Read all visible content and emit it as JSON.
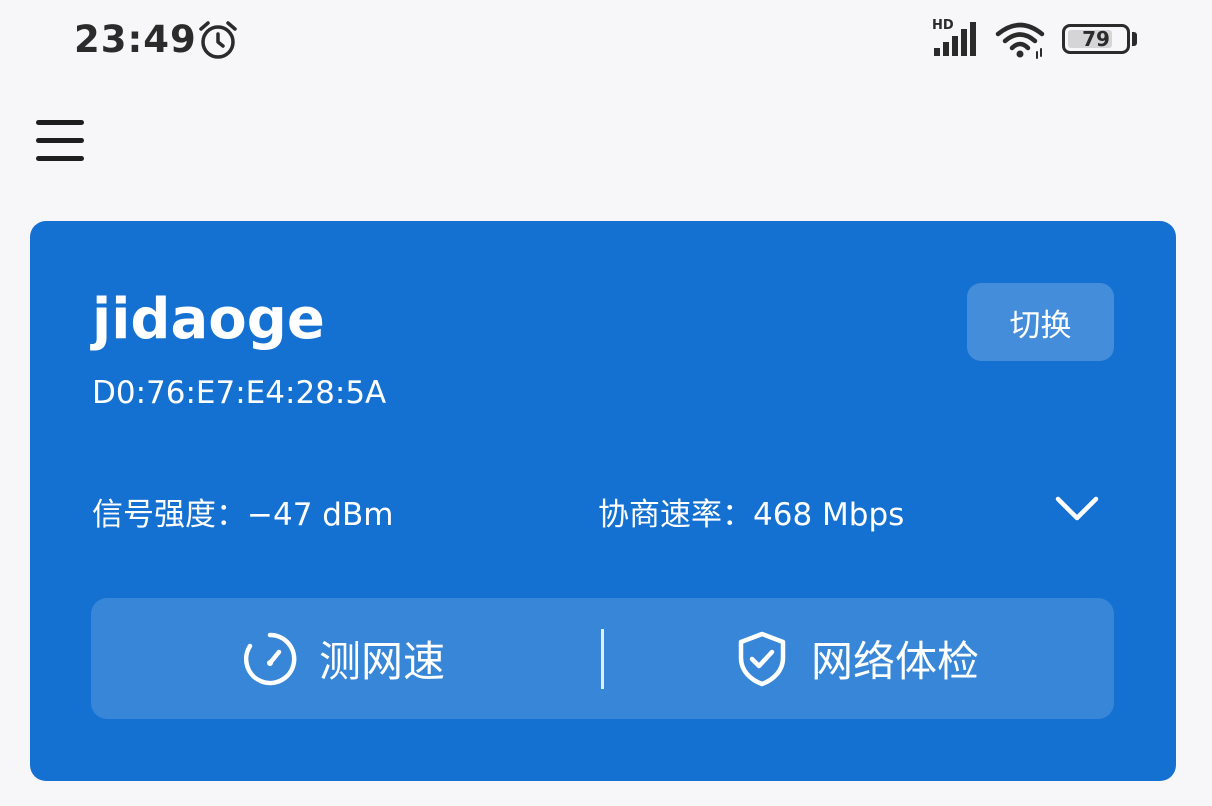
{
  "status_bar": {
    "time": "23:49",
    "network_type": "HD",
    "battery_level": "79",
    "battery_fraction": 0.79
  },
  "icons": {
    "menu": "menu-icon",
    "alarm": "alarm-icon",
    "signal": "cellular-signal-icon",
    "wifi": "wifi-icon",
    "battery": "battery-icon",
    "expand": "chevron-down-icon",
    "speed": "speedometer-icon",
    "check": "shield-check-icon"
  },
  "colors": {
    "card_background": "#1471d1",
    "page_background": "#f7f7f9",
    "text_light": "#ffffff"
  },
  "wifi_card": {
    "ssid": "jidaoge",
    "bssid": "D0:76:E7:E4:28:5A",
    "switch_label": "切换",
    "signal_strength": "信号强度：−47 dBm",
    "link_rate": "协商速率：468 Mbps",
    "actions": {
      "speed_test_label": "测网速",
      "network_check_label": "网络体检"
    }
  }
}
